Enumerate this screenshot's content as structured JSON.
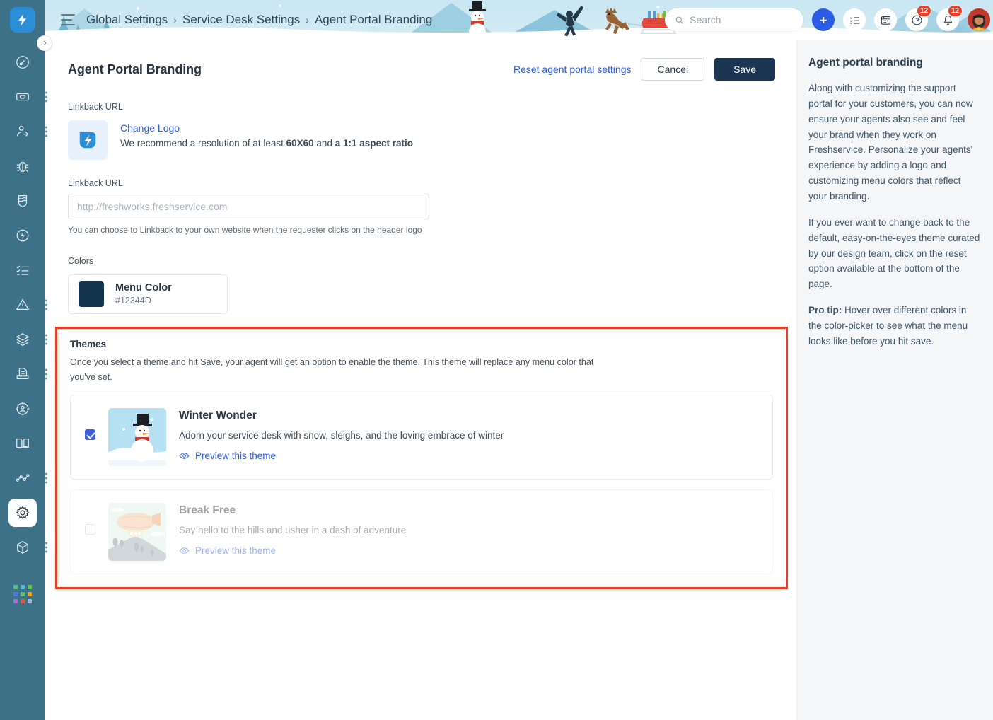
{
  "rail": {
    "logo_icon": "freshservice-bolt-logo",
    "expand_icon": "chevron-right-icon",
    "items": [
      {
        "name": "dashboard-icon",
        "has_dots": false
      },
      {
        "name": "tickets-icon",
        "has_dots": true
      },
      {
        "name": "service-requests-icon",
        "has_dots": true
      },
      {
        "name": "problems-bug-icon",
        "has_dots": false
      },
      {
        "name": "changes-shield-icon",
        "has_dots": false
      },
      {
        "name": "releases-bolt-icon",
        "has_dots": false
      },
      {
        "name": "tasks-checklist-icon",
        "has_dots": false
      },
      {
        "name": "alerts-warning-icon",
        "has_dots": true
      },
      {
        "name": "assets-layers-icon",
        "has_dots": true
      },
      {
        "name": "contracts-document-icon",
        "has_dots": true
      },
      {
        "name": "projects-target-icon",
        "has_dots": false
      },
      {
        "name": "solutions-book-icon",
        "has_dots": false
      },
      {
        "name": "analytics-graph-icon",
        "has_dots": true
      },
      {
        "name": "settings-gear-icon",
        "has_dots": false,
        "active": true
      },
      {
        "name": "apps-cube-icon",
        "has_dots": true
      }
    ],
    "grid_colors": [
      "#55c08a",
      "#4fc3d9",
      "#6bbf59",
      "#4b7bd6",
      "#5ec26a",
      "#f0a02a",
      "#a06fd0",
      "#e8503a",
      "#9fb8d8"
    ]
  },
  "topbar": {
    "menu_icon": "hamburger-menu-icon",
    "breadcrumb": [
      "Global Settings",
      "Service Desk Settings",
      "Agent Portal Branding"
    ],
    "separator": "›",
    "search": {
      "placeholder": "Search",
      "value": "",
      "icon": "search-icon"
    },
    "add_icon": "plus-icon",
    "tasks_icon": "checklist-icon",
    "calendar_icon": "calendar-icon",
    "help_icon": "question-mark-icon",
    "help_badge": "12",
    "bell_icon": "bell-icon",
    "bell_badge": "12",
    "avatar_name": "user-avatar"
  },
  "page": {
    "title": "Agent Portal Branding",
    "reset_link": "Reset agent portal settings",
    "cancel_label": "Cancel",
    "save_label": "Save"
  },
  "linkback_section": {
    "label": "Linkback URL",
    "change_logo": "Change Logo",
    "logo_hint_prefix": "We recommend a resolution of at least ",
    "logo_hint_bold1": "60X60",
    "logo_hint_mid": " and ",
    "logo_hint_bold2": "a 1:1 aspect ratio",
    "field_label": "Linkback URL",
    "placeholder": "http://freshworks.freshservice.com",
    "value": "",
    "hint": "You can choose to Linkback to your own website when the requester clicks on the header logo"
  },
  "colors_section": {
    "label": "Colors",
    "menu_color_name": "Menu Color",
    "menu_color_hex": "#12344D"
  },
  "themes_section": {
    "title": "Themes",
    "description": "Once you select a theme and hit Save, your agent will get an option to enable the theme. This theme will replace any menu color that you've set.",
    "highlight_color": "#e8401f",
    "themes": [
      {
        "name": "Winter Wonder",
        "description": "Adorn your service desk with snow, sleighs, and the loving embrace of winter",
        "preview_label": "Preview this theme",
        "preview_icon": "eye-icon",
        "checked": true,
        "thumbnail": "snowman-winter-thumbnail"
      },
      {
        "name": "Break Free",
        "description": "Say hello to the hills and usher in a dash of adventure",
        "preview_label": "Preview this theme",
        "preview_icon": "eye-icon",
        "checked": false,
        "thumbnail": "airship-hills-thumbnail"
      }
    ]
  },
  "help_panel": {
    "title": "Agent portal branding",
    "para1": "Along with customizing the support portal for your customers, you can now ensure your agents also see and feel your brand when they work on Freshservice. Personalize your agents' experience by adding a logo and customizing menu colors that reflect your branding.",
    "para2": "If you ever want to change back to the default, easy-on-the-eyes theme curated by our design team, click on the reset option available at the bottom of the page.",
    "para3_bold": "Pro tip:",
    "para3": " Hover over different colors in the color-picker to see what the menu looks like before you hit save."
  }
}
